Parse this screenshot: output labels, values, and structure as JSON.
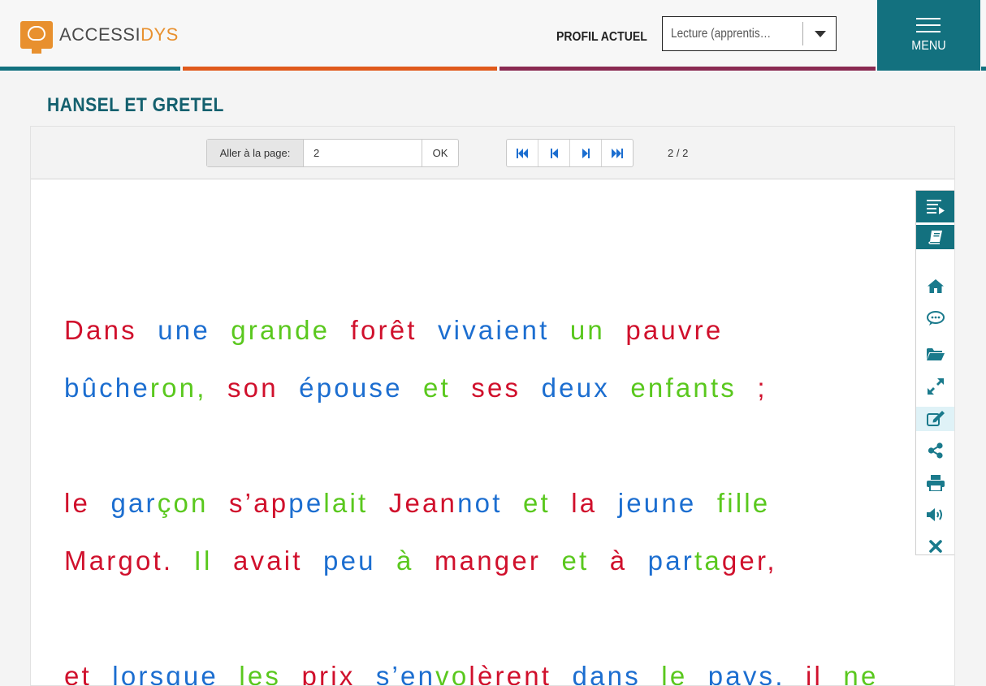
{
  "app": {
    "logo": {
      "part1": "ACCESSI",
      "part2": "DYS"
    },
    "profile_label": "PROFIL ACTUEL",
    "profile_value": "Lecture (apprentis…",
    "menu_label": "MENU",
    "colors": {
      "teal": "#13717f",
      "orange": "#e8902e",
      "stripe_orange": "#e05a1c",
      "stripe_purple": "#8a2a52",
      "red": "#d0102c",
      "blue": "#1c6ed0",
      "green": "#5ac81e"
    }
  },
  "document": {
    "title": "HANSEL ET GRETEL"
  },
  "toolbar": {
    "goto_label": "Aller à la page:",
    "goto_value": "2",
    "ok_label": "OK",
    "page_count": "2 / 2",
    "nav": [
      "first-page-icon",
      "previous-page-icon",
      "next-page-icon",
      "last-page-icon"
    ]
  },
  "text_lines": [
    [
      [
        "Dans ",
        "r"
      ],
      [
        "une ",
        "b"
      ],
      [
        "grande ",
        "g"
      ],
      [
        "forêt ",
        "r"
      ],
      [
        "vivaient ",
        "b"
      ],
      [
        "un ",
        "g"
      ],
      [
        "pauvre",
        "r"
      ]
    ],
    [
      [
        "bûche",
        "b"
      ],
      [
        "ron, ",
        "g"
      ],
      [
        "son ",
        "r"
      ],
      [
        "épouse ",
        "b"
      ],
      [
        "et ",
        "g"
      ],
      [
        "ses ",
        "r"
      ],
      [
        "deux ",
        "b"
      ],
      [
        "enfants ",
        "g"
      ],
      [
        ";",
        "r"
      ]
    ],
    [
      [
        "le ",
        "r"
      ],
      [
        "gar",
        "b"
      ],
      [
        "çon ",
        "g"
      ],
      [
        "s’ap",
        "r"
      ],
      [
        "pe",
        "b"
      ],
      [
        "lait ",
        "g"
      ],
      [
        "Jean",
        "r"
      ],
      [
        "not ",
        "b"
      ],
      [
        "et ",
        "g"
      ],
      [
        "la ",
        "r"
      ],
      [
        "jeune ",
        "b"
      ],
      [
        "fille",
        "g"
      ]
    ],
    [
      [
        "Margot. ",
        "r"
      ],
      [
        "Il ",
        "g"
      ],
      [
        "avait ",
        "r"
      ],
      [
        "peu ",
        "b"
      ],
      [
        "à ",
        "g"
      ],
      [
        "manger ",
        "r"
      ],
      [
        "et ",
        "g"
      ],
      [
        "à ",
        "r"
      ],
      [
        "par",
        "b"
      ],
      [
        "ta",
        "g"
      ],
      [
        "ger,",
        "r"
      ]
    ],
    [
      [
        "et ",
        "r"
      ],
      [
        "lorsque ",
        "b"
      ],
      [
        "les ",
        "g"
      ],
      [
        "prix ",
        "r"
      ],
      [
        "s’en",
        "b"
      ],
      [
        "vo",
        "g"
      ],
      [
        "lèrent ",
        "r"
      ],
      [
        "dans ",
        "b"
      ],
      [
        "le ",
        "g"
      ],
      [
        "pays, ",
        "b"
      ],
      [
        "il ",
        "r"
      ],
      [
        "ne",
        "g"
      ]
    ]
  ],
  "side_tools": [
    "text-list-icon",
    "book-icon",
    "home-icon",
    "comment-icon",
    "folder-open-icon",
    "expand-icon",
    "edit-icon",
    "share-icon",
    "print-icon",
    "volume-icon",
    "close-icon"
  ]
}
